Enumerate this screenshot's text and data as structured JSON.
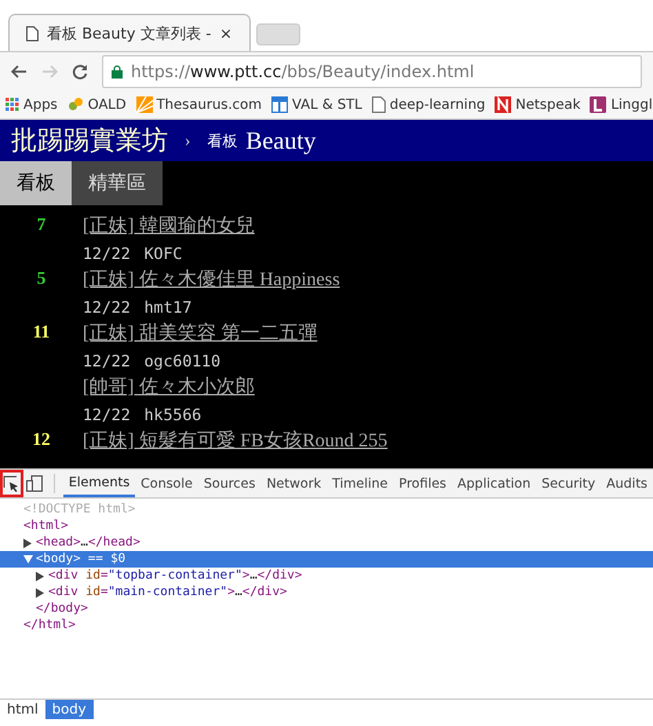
{
  "browser_tabs": [
    {
      "title": "看板 Beauty 文章列表 -",
      "close": "×",
      "selected": true
    }
  ],
  "address_bar": {
    "scheme": "https://",
    "host": "www.ptt.cc",
    "path": "/bbs/Beauty/index.html"
  },
  "bookmarks": [
    {
      "label": "Apps",
      "kind": "apps"
    },
    {
      "label": "OALD",
      "kind": "flower"
    },
    {
      "label": "Thesaurus.com",
      "kind": "sun"
    },
    {
      "label": "VAL & STL",
      "kind": "window"
    },
    {
      "label": "deep-learning",
      "kind": "page"
    },
    {
      "label": "Netspeak",
      "kind": "n"
    },
    {
      "label": "Linggl",
      "kind": "l"
    }
  ],
  "site": {
    "logo": "批踢踢實業坊",
    "separator": "›",
    "board_label": "看板",
    "board_name": "Beauty"
  },
  "site_tabs": [
    {
      "label": "看板",
      "selected": true
    },
    {
      "label": "精華區",
      "selected": false
    }
  ],
  "posts": [
    {
      "count": "7",
      "color": "#33cc33",
      "title": "[正妹] 韓國瑜的女兒",
      "date": "12/22",
      "author": "KOFC"
    },
    {
      "count": "5",
      "color": "#33cc33",
      "title": "[正妹] 佐々木優佳里 Happiness",
      "date": "12/22",
      "author": "hmt17"
    },
    {
      "count": "11",
      "color": "#ffff66",
      "title": "[正妹] 甜美笑容 第一二五彈",
      "date": "12/22",
      "author": "ogc60110"
    },
    {
      "title": "[帥哥] 佐々木小次郎",
      "date": "12/22",
      "author": "hk5566"
    },
    {
      "count": "12",
      "color": "#ffff66",
      "title": "[正妹] 短髮有可愛 FB女孩Round 255"
    }
  ],
  "devtools": {
    "tools": [
      {
        "kind": "inspect",
        "highlighted": true
      },
      {
        "kind": "device",
        "highlighted": false
      }
    ],
    "tabs": [
      {
        "label": "Elements",
        "selected": true
      },
      {
        "label": "Console",
        "selected": false
      },
      {
        "label": "Sources",
        "selected": false
      },
      {
        "label": "Network",
        "selected": false
      },
      {
        "label": "Timeline",
        "selected": false
      },
      {
        "label": "Profiles",
        "selected": false
      },
      {
        "label": "Application",
        "selected": false
      },
      {
        "label": "Security",
        "selected": false
      },
      {
        "label": "Audits",
        "selected": false
      }
    ],
    "dom_tree": [
      {
        "parts": [
          {
            "kind": "doctype",
            "text": "<!DOCTYPE html>"
          }
        ]
      },
      {
        "parts": [
          {
            "kind": "tag",
            "text": "<html>"
          }
        ],
        "children": [
          {
            "expanded": false,
            "selected": false,
            "parts": [
              {
                "kind": "tag",
                "text": "<head>"
              },
              {
                "kind": "plain",
                "text": "…"
              },
              {
                "kind": "tag",
                "text": "</head>"
              }
            ]
          },
          {
            "expanded": true,
            "selected": true,
            "parts": [
              {
                "kind": "tag",
                "text": "<body>"
              },
              {
                "kind": "plain",
                "text": " == $0"
              }
            ],
            "children": [
              {
                "expanded": false,
                "selected": false,
                "parts": [
                  {
                    "kind": "tag",
                    "text": "<div "
                  },
                  {
                    "kind": "attr",
                    "text": "id"
                  },
                  {
                    "kind": "tag",
                    "text": "="
                  },
                  {
                    "kind": "value",
                    "text": "\"topbar-container\""
                  },
                  {
                    "kind": "tag",
                    "text": ">"
                  },
                  {
                    "kind": "plain",
                    "text": "…"
                  },
                  {
                    "kind": "tag",
                    "text": "</div>"
                  }
                ]
              },
              {
                "expanded": false,
                "selected": false,
                "parts": [
                  {
                    "kind": "tag",
                    "text": "<div "
                  },
                  {
                    "kind": "attr",
                    "text": "id"
                  },
                  {
                    "kind": "tag",
                    "text": "="
                  },
                  {
                    "kind": "value",
                    "text": "\"main-container\""
                  },
                  {
                    "kind": "tag",
                    "text": ">"
                  },
                  {
                    "kind": "plain",
                    "text": "…"
                  },
                  {
                    "kind": "tag",
                    "text": "</div>"
                  }
                ]
              }
            ],
            "closing": "</body>"
          }
        ],
        "closing": "</html>"
      }
    ],
    "breadcrumbs": [
      {
        "label": "html",
        "selected": false
      },
      {
        "label": "body",
        "selected": true
      }
    ]
  }
}
